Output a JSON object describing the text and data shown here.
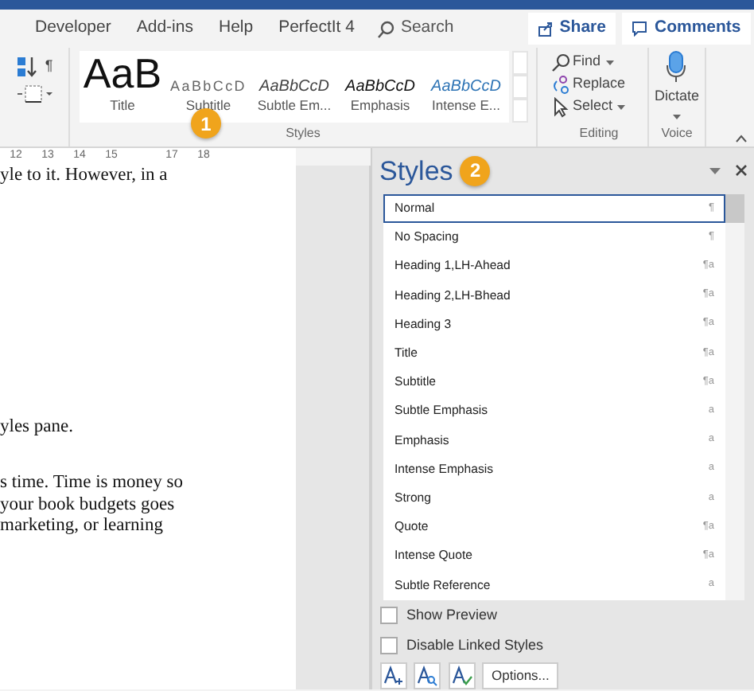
{
  "tabs": [
    {
      "label": "Developer"
    },
    {
      "label": "Add-ins"
    },
    {
      "label": "Help"
    },
    {
      "label": "PerfectIt 4"
    }
  ],
  "search": {
    "placeholder": "Search"
  },
  "share_button": "Share",
  "comments_button": "Comments",
  "ribbon": {
    "paragraph_mark": "¶",
    "styles_group": {
      "label": "Styles",
      "callout": "1",
      "items": [
        {
          "preview": "AaB",
          "label": "Title",
          "kind": "title"
        },
        {
          "preview": "AaBbCcD",
          "label": "Subtitle",
          "kind": "subtitle"
        },
        {
          "preview": "AaBbCcD",
          "label": "Subtle Em...",
          "kind": "subtle"
        },
        {
          "preview": "AaBbCcD",
          "label": "Emphasis",
          "kind": "emphasis"
        },
        {
          "preview": "AaBbCcD",
          "label": "Intense E...",
          "kind": "intense"
        }
      ]
    },
    "editing_group": {
      "label": "Editing",
      "items": [
        {
          "label": "Find",
          "kind": "find"
        },
        {
          "label": "Replace",
          "kind": "replace"
        },
        {
          "label": "Select",
          "kind": "select"
        }
      ]
    },
    "voice_group": {
      "label": "Voice",
      "button": "Dictate"
    }
  },
  "ruler": {
    "ticks": [
      "12",
      "13",
      "14",
      "15",
      "17",
      "18"
    ]
  },
  "document": {
    "lines": [
      {
        "text": "yle to it. However, in a"
      },
      {
        "text": "yles pane."
      },
      {
        "text": "s time. Time is money so"
      },
      {
        "text": "your book budgets goes"
      },
      {
        "text": "marketing, or learning"
      }
    ]
  },
  "styles_pane": {
    "title": "Styles",
    "callout": "2",
    "styles": [
      {
        "name": "Normal",
        "symbol": "¶",
        "selected": true
      },
      {
        "name": "No Spacing",
        "symbol": "¶",
        "selected": false
      },
      {
        "name": "Heading 1,LH-Ahead",
        "symbol": "¶a",
        "selected": false
      },
      {
        "name": "Heading 2,LH-Bhead",
        "symbol": "¶a",
        "selected": false
      },
      {
        "name": "Heading 3",
        "symbol": "¶a",
        "selected": false
      },
      {
        "name": "Title",
        "symbol": "¶a",
        "selected": false
      },
      {
        "name": "Subtitle",
        "symbol": "¶a",
        "selected": false
      },
      {
        "name": "Subtle Emphasis",
        "symbol": "a",
        "selected": false
      },
      {
        "name": "Emphasis",
        "symbol": "a",
        "selected": false
      },
      {
        "name": "Intense Emphasis",
        "symbol": "a",
        "selected": false
      },
      {
        "name": "Strong",
        "symbol": "a",
        "selected": false
      },
      {
        "name": "Quote",
        "symbol": "¶a",
        "selected": false
      },
      {
        "name": "Intense Quote",
        "symbol": "¶a",
        "selected": false
      },
      {
        "name": "Subtle Reference",
        "symbol": "a",
        "selected": false
      }
    ],
    "options": [
      {
        "label": "Show Preview",
        "checked": false
      },
      {
        "label": "Disable Linked Styles",
        "checked": false
      }
    ],
    "options_button": "Options..."
  }
}
